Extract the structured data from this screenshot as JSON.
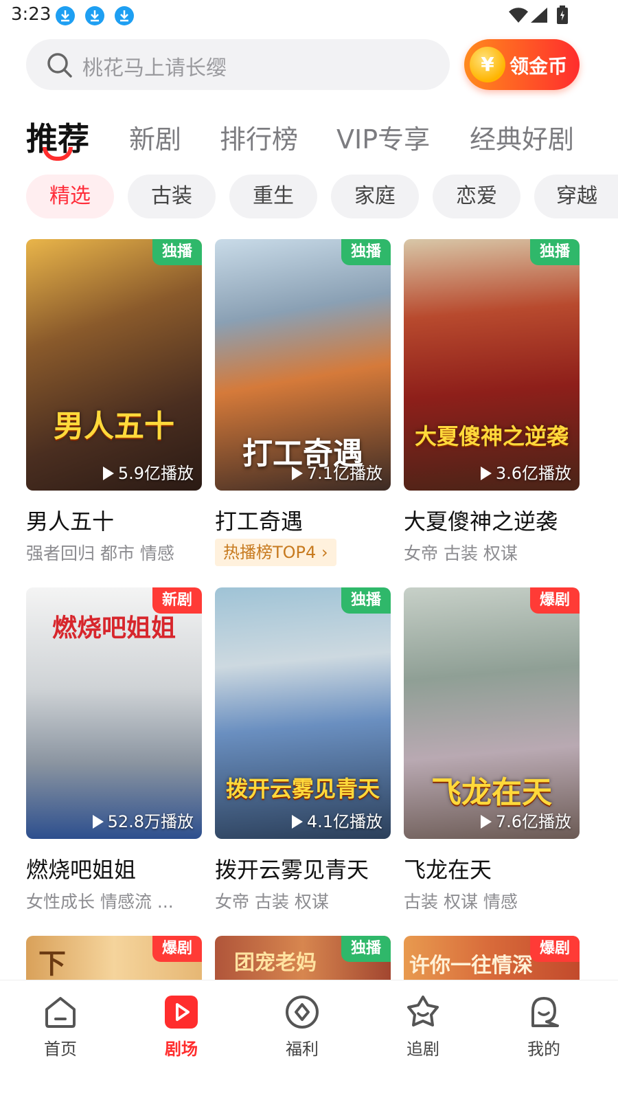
{
  "status_bar": {
    "time": "3:23"
  },
  "search": {
    "placeholder": "桃花马上请长缨"
  },
  "coin_button": {
    "label": "领金币",
    "symbol": "¥"
  },
  "top_tabs": [
    "推荐",
    "新剧",
    "排行榜",
    "VIP专享",
    "经典好剧"
  ],
  "chips": [
    "精选",
    "古装",
    "重生",
    "家庭",
    "恋爱",
    "穿越"
  ],
  "cards": [
    {
      "title": "男人五十",
      "poster_text": "男人五十",
      "badge": "独播",
      "plays": "5.9亿播放",
      "tags": "强者回归 都市 情感"
    },
    {
      "title": "打工奇遇",
      "poster_text": "打工奇遇",
      "badge": "独播",
      "plays": "7.1亿播放",
      "rank": "热播榜TOP4"
    },
    {
      "title": "大夏傻神之逆袭",
      "poster_text": "大夏傻神之逆袭",
      "badge": "独播",
      "plays": "3.6亿播放",
      "tags": "女帝 古装 权谋"
    },
    {
      "title": "燃烧吧姐姐",
      "poster_text": "燃烧吧姐姐",
      "badge": "新剧",
      "plays": "52.8万播放",
      "tags": "女性成长 情感流 ..."
    },
    {
      "title": "拨开云雾见青天",
      "poster_text": "拨开云雾见青天",
      "badge": "独播",
      "plays": "4.1亿播放",
      "tags": "女帝 古装 权谋"
    },
    {
      "title": "飞龙在天",
      "poster_text": "飞龙在天",
      "badge": "爆剧",
      "plays": "7.6亿播放",
      "tags": "古装 权谋 情感"
    },
    {
      "poster_text": "下",
      "badge": "爆剧"
    },
    {
      "poster_text": "团宠老妈",
      "badge": "独播"
    },
    {
      "poster_text": "许你一往情深",
      "badge": "爆剧"
    }
  ],
  "bottom_nav": [
    "首页",
    "剧场",
    "福利",
    "追剧",
    "我的"
  ],
  "colors": {
    "accent": "#ff2d2d",
    "badge_green": "#2fb86a",
    "badge_red": "#ff3b36"
  }
}
